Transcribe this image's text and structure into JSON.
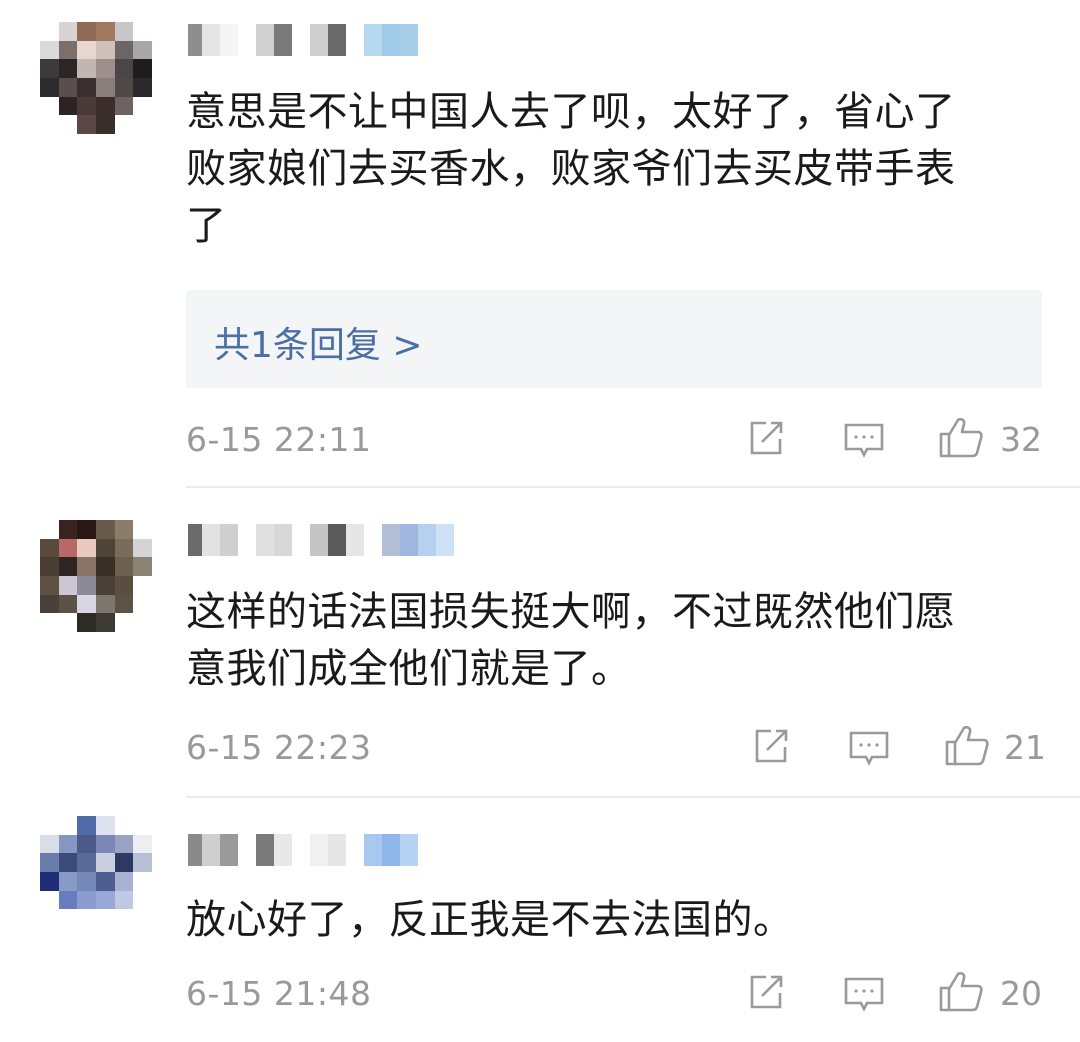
{
  "comments": [
    {
      "text": "意思是不让中国人去了呗，太好了，省心了\n败家娘们去买香水，败家爷们去买皮带手表\n了",
      "reply_link": "共1条回复 >",
      "time": "6-15 22:11",
      "likes": "32"
    },
    {
      "text": "这样的话法国损失挺大啊，不过既然他们愿\n意我们成全他们就是了。",
      "time": "6-15 22:23",
      "likes": "21"
    },
    {
      "text": "放心好了，反正我是不去法国的。",
      "time": "6-15 21:48",
      "likes": "20"
    }
  ],
  "icons": {
    "share": "share-icon",
    "comment": "comment-icon",
    "like": "thumbs-up-icon"
  },
  "colors": {
    "body_text": "#1a1a1a",
    "meta_text": "#999999",
    "reply_link": "#4a6fa5",
    "reply_bg": "#f4f5f7",
    "divider": "#ececec"
  }
}
